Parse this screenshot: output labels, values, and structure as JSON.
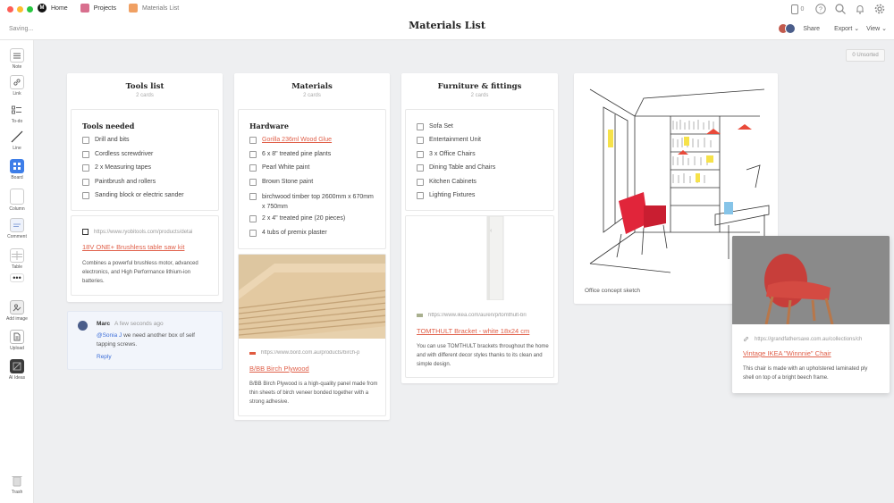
{
  "window": {
    "dot_colors": [
      "#fd5f57",
      "#fdbc2e",
      "#28c840"
    ]
  },
  "breadcrumbs": [
    {
      "label": "Home",
      "color": "#111111"
    },
    {
      "label": "Projects",
      "color": "#d86f8e"
    },
    {
      "label": "Materials List",
      "color": "#f0a063"
    }
  ],
  "status": "Saving...",
  "title": "Materials List",
  "topbar": {
    "device_count": "0",
    "share": "Share",
    "export": "Export",
    "view": "View"
  },
  "toolbar": [
    {
      "label": "Note"
    },
    {
      "label": "Link"
    },
    {
      "label": "To-do"
    },
    {
      "label": "Line"
    },
    {
      "label": "Board"
    },
    {
      "label": "Column"
    },
    {
      "label": "Comment"
    },
    {
      "label": "Table"
    },
    {
      "label": "Add image"
    },
    {
      "label": "Upload"
    },
    {
      "label": "AI Ideas"
    },
    {
      "label": "Trash"
    }
  ],
  "unsorted": "0 Unsorted",
  "columns": {
    "tools": {
      "title": "Tools list",
      "count": "2 cards",
      "todo_title": "Tools needed",
      "items": [
        "Drill and bits",
        "Cordless screwdriver",
        "2 x Measuring tapes",
        "Paintbrush and rollers",
        "Sanding block or electric sander"
      ],
      "link": {
        "url": "https://www.ryobitools.com/products/detai",
        "title": "18V ONE+ Brushless table saw kit",
        "desc": "Combines a powerful brushless motor, advanced electronics, and High Performance lithium-ion batteries."
      },
      "comment": {
        "author": "Marc",
        "time": "A few seconds ago",
        "mention": "@Sonia J",
        "text": " we need another box of self tapping screws.",
        "reply": "Reply"
      }
    },
    "materials": {
      "title": "Materials",
      "count": "2 cards",
      "todo_title": "Hardware",
      "items": [
        "Gorilla 236ml Wood Glue",
        "6 x 8\" treated pine plants",
        "Pearl White paint",
        "Brown Stone paint",
        "birchwood timber top 2600mm x 670mm x 750mm",
        "2 x 4\" treated pine (20 pieces)",
        "4 tubs of premix plaster"
      ],
      "link": {
        "url": "https://www.bord.com.au/products/birch-p",
        "title": "B/BB Birch Plywood",
        "desc": "B/BB Birch Plywood is a high-quality panel made from thin sheets of birch veneer bonded together with a strong adhesive."
      }
    },
    "furniture": {
      "title": "Furniture & fittings",
      "count": "2 cards",
      "items": [
        "Sofa Set",
        "Entertainment Unit",
        "3 x Office Chairs",
        "Dining Table and Chairs",
        "Kitchen Cabinets",
        "Lighting Fixtures"
      ],
      "link": {
        "url": "https://www.ikea.com/au/en/p/tomthult-bri",
        "title": "TOMTHULT Bracket - white 18x24 cm",
        "desc": "You can use TOMTHULT brackets throughout the home and with different decor styles thanks to its clean and simple design."
      }
    }
  },
  "sketch": {
    "caption": "Office concept sketch"
  },
  "chair": {
    "url": "https://grandfathersaxe.com.au/collections/ch",
    "title": "Vintage IKEA \"Winnnie\" Chair",
    "desc": "This chair is made with an upholstered laminated ply shell on top of a bright beech frame."
  }
}
